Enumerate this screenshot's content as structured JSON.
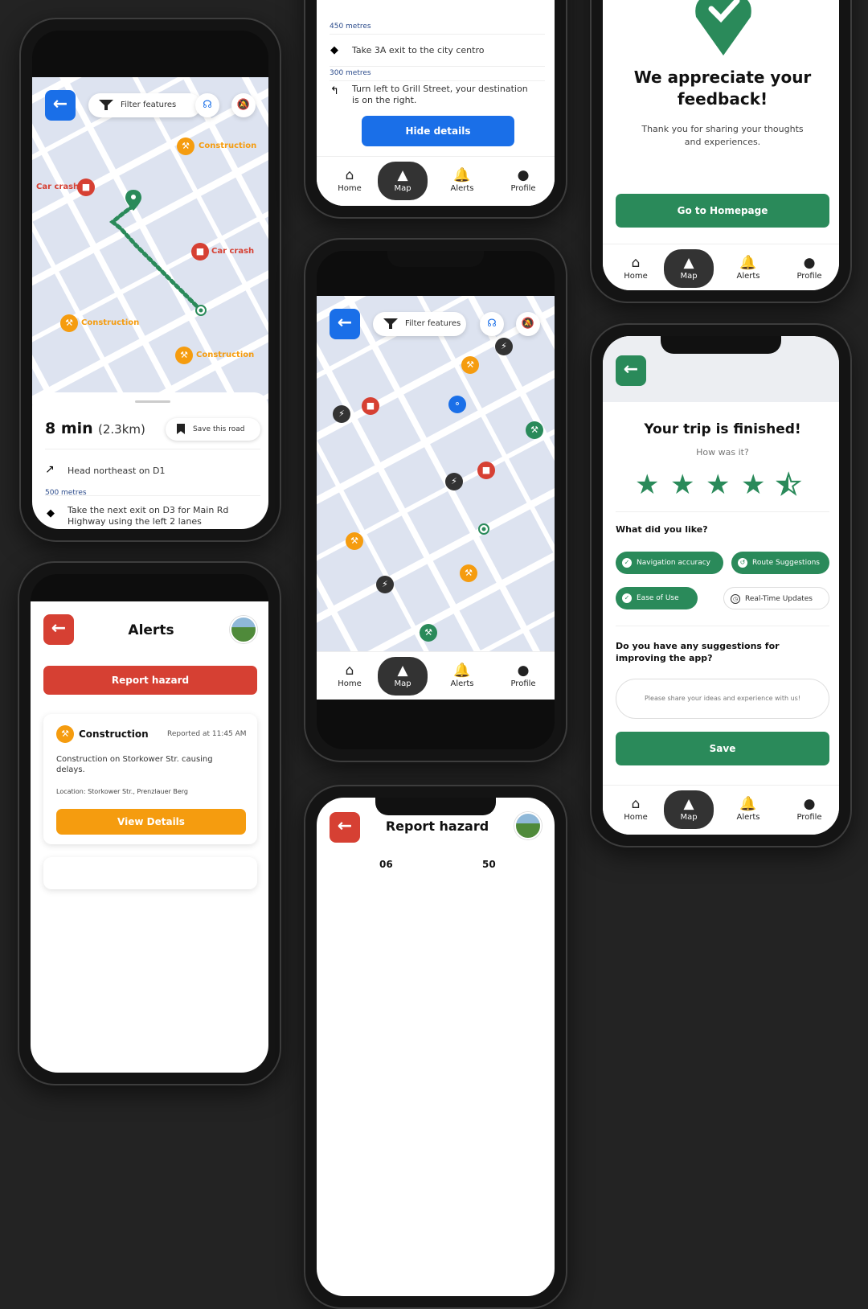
{
  "nav": {
    "home": "Home",
    "map": "Map",
    "alerts": "Alerts",
    "profile": "Profile"
  },
  "map_screen": {
    "filter": "Filter features",
    "pins": [
      {
        "label": "Construction",
        "type": "construction"
      },
      {
        "label": "Car crash",
        "type": "crash"
      },
      {
        "label": "Car crash",
        "type": "crash"
      },
      {
        "label": "Construction",
        "type": "construction"
      },
      {
        "label": "Construction",
        "type": "construction"
      }
    ],
    "route": {
      "time": "8 min",
      "distance": "(2.3km)",
      "save": "Save this road",
      "step1": "Head northeast on D1",
      "dist1": "500 metres",
      "step2": "Take the next exit on D3 for Main Rd Highway using the left 2 lanes"
    }
  },
  "directions_screen": {
    "dist_a": "450 metres",
    "step_a": "Take 3A exit to the city centro",
    "dist_b": "300 metres",
    "step_b": "Turn left to Grill Street, your destination is on the right.",
    "hide": "Hide details"
  },
  "feedback_thanks": {
    "title": "We appreciate your feedback!",
    "subtitle": "Thank you for sharing your thoughts and experiences.",
    "button": "Go to Homepage"
  },
  "middle_map": {
    "filter": "Filter features"
  },
  "trip_finished": {
    "title": "Your trip is finished!",
    "subtitle": "How was it?",
    "rating": 4.5,
    "liked_title": "What did you like?",
    "chips": [
      "Navigation accuracy",
      "Route Suggestions",
      "Ease of Use",
      "Real-Time Updates"
    ],
    "suggest_title": "Do you have any suggestions for improving the app?",
    "placeholder": "Please share your ideas and experience with us!",
    "save": "Save"
  },
  "alerts_screen": {
    "title": "Alerts",
    "report": "Report hazard",
    "card_title": "Construction",
    "reported": "Reported at 11:45 AM",
    "desc": "Construction on Storkower Str. causing delays.",
    "location": "Location: Storkower Str., Prenzlauer Berg",
    "view": "View Details"
  },
  "report_screen": {
    "title": "Report hazard",
    "num_a": "06",
    "num_b": "50"
  },
  "colors": {
    "accent_blue": "#1a6fe8",
    "green": "#2a8a5a",
    "red": "#d64033",
    "orange": "#f59c0f"
  }
}
